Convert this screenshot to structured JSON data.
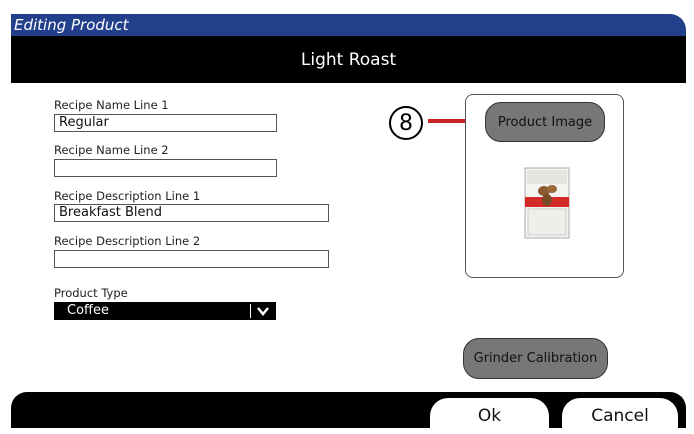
{
  "header": {
    "title": "Editing Product"
  },
  "product": {
    "name": "Light Roast"
  },
  "form": {
    "recipe_name_1": {
      "label": "Recipe Name Line 1",
      "value": "Regular"
    },
    "recipe_name_2": {
      "label": "Recipe Name Line 2",
      "value": ""
    },
    "recipe_desc_1": {
      "label": "Recipe Description Line 1",
      "value": "Breakfast Blend"
    },
    "recipe_desc_2": {
      "label": "Recipe Description Line 2",
      "value": ""
    },
    "product_type": {
      "label": "Product Type",
      "value": "Coffee"
    }
  },
  "image_panel": {
    "button_label": "Product Image",
    "callout_number": "8"
  },
  "grinder": {
    "button_label": "Grinder Calibration"
  },
  "footer": {
    "ok_label": "Ok",
    "cancel_label": "Cancel"
  },
  "colors": {
    "header_blue": "#223f8c",
    "callout_red": "#c8262b",
    "button_gray": "#777777"
  }
}
